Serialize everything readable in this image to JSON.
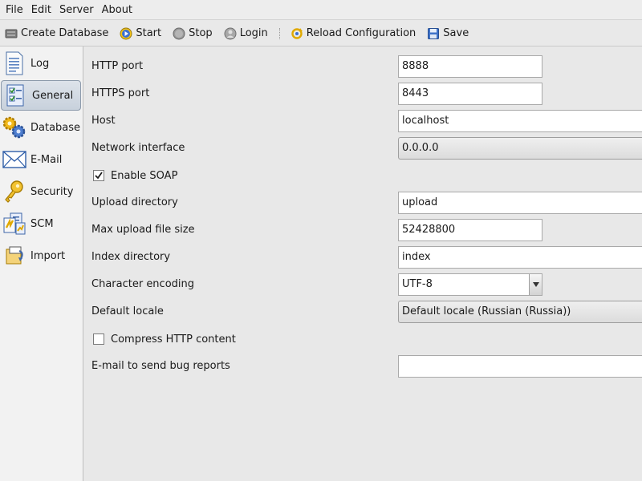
{
  "menu": {
    "file": "File",
    "edit": "Edit",
    "server": "Server",
    "about": "About"
  },
  "toolbar": {
    "create_database": "Create Database",
    "start": "Start",
    "stop": "Stop",
    "login": "Login",
    "reload_configuration": "Reload Configuration",
    "save": "Save"
  },
  "sidebar": {
    "items": [
      {
        "label": "Log",
        "icon": "log-document-icon"
      },
      {
        "label": "General",
        "icon": "checklist-icon",
        "selected": true
      },
      {
        "label": "Database",
        "icon": "gears-icon"
      },
      {
        "label": "E-Mail",
        "icon": "envelope-icon"
      },
      {
        "label": "Security",
        "icon": "key-icon"
      },
      {
        "label": "SCM",
        "icon": "scm-icon"
      },
      {
        "label": "Import",
        "icon": "import-icon"
      }
    ]
  },
  "form": {
    "http_port": {
      "label": "HTTP port",
      "value": "8888"
    },
    "https_port": {
      "label": "HTTPS port",
      "value": "8443"
    },
    "host": {
      "label": "Host",
      "value": "localhost"
    },
    "network_interface": {
      "label": "Network interface",
      "value": "0.0.0.0"
    },
    "enable_soap": {
      "label": "Enable SOAP",
      "checked": true
    },
    "upload_directory": {
      "label": "Upload directory",
      "value": "upload"
    },
    "max_upload_file_size": {
      "label": "Max upload file size",
      "value": "52428800"
    },
    "index_directory": {
      "label": "Index directory",
      "value": "index"
    },
    "character_encoding": {
      "label": "Character encoding",
      "value": "UTF-8"
    },
    "default_locale": {
      "label": "Default locale",
      "value": "Default locale (Russian (Russia))"
    },
    "compress_http": {
      "label": "Compress HTTP content",
      "checked": false
    },
    "bug_email": {
      "label": "E-mail to send bug reports",
      "value": ""
    }
  }
}
